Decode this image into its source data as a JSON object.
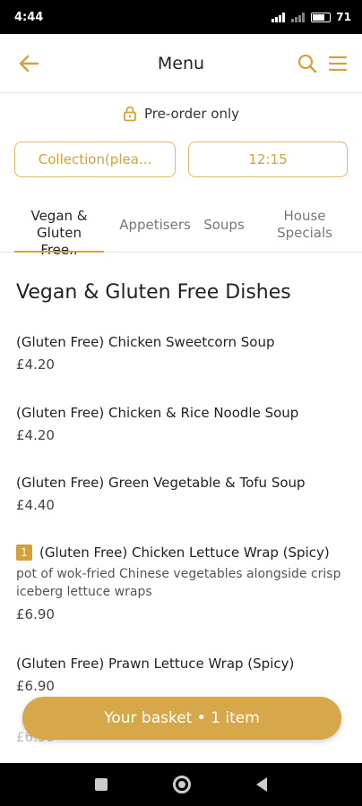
{
  "status_bar": {
    "time": "4:44",
    "battery": "71"
  },
  "header": {
    "title": "Menu"
  },
  "preorder": {
    "text": "Pre-order only"
  },
  "options": {
    "collection": "Collection(plea...",
    "time": "12:15"
  },
  "tabs": [
    {
      "line1": "Vegan &",
      "line2": "Gluten Free.."
    },
    {
      "line1": "Appetisers",
      "line2": ""
    },
    {
      "line1": "Soups",
      "line2": ""
    },
    {
      "line1": "House",
      "line2": "Specials"
    }
  ],
  "section": {
    "title": "Vegan & Gluten Free Dishes"
  },
  "items": [
    {
      "name": "(Gluten Free) Chicken Sweetcorn Soup",
      "price": "£4.20"
    },
    {
      "name": "(Gluten Free) Chicken & Rice Noodle Soup",
      "price": "£4.20"
    },
    {
      "name": "(Gluten Free) Green Vegetable & Tofu Soup",
      "price": "£4.40"
    },
    {
      "name": "(Gluten Free) Chicken Lettuce Wrap (Spicy)",
      "qty": "1",
      "description": "pot of wok-fried Chinese vegetables alongside crisp iceberg lettuce wraps",
      "price": "£6.90"
    },
    {
      "name": "(Gluten Free) Prawn Lettuce Wrap (Spicy)",
      "price": "£6.90"
    },
    {
      "name": "",
      "price": "£6.90"
    }
  ],
  "basket": {
    "label": "Your basket • 1 item"
  },
  "colors": {
    "accent": "#d4a23a",
    "basket_bg": "#d6a849"
  }
}
